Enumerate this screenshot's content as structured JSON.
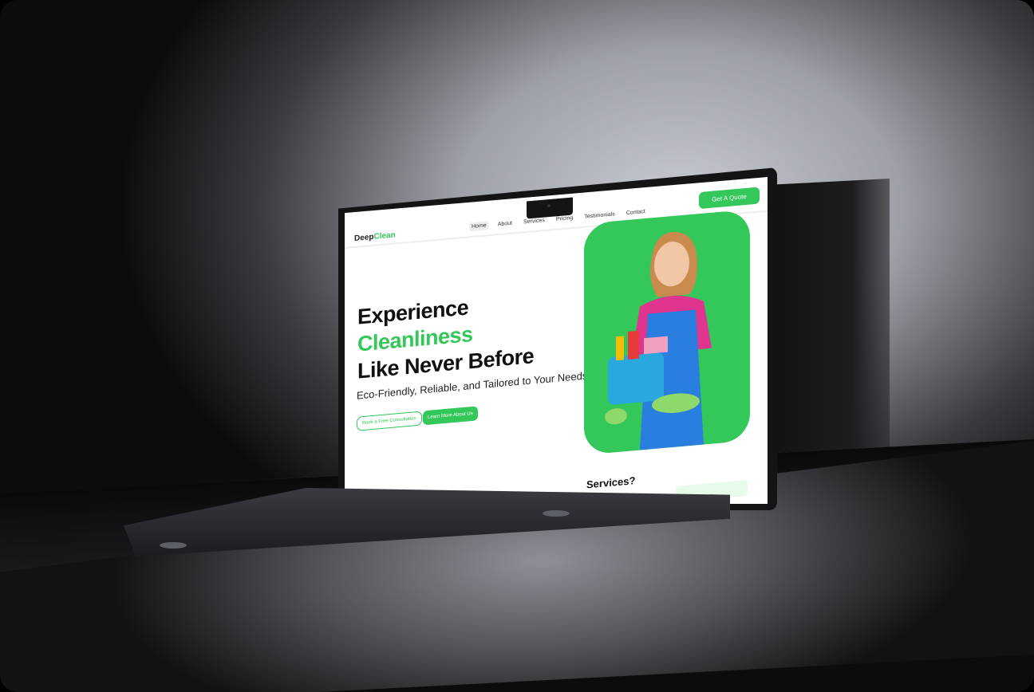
{
  "site": {
    "logo": {
      "part1": "Deep",
      "part2": "Clean"
    },
    "nav": [
      {
        "label": "Home",
        "active": true
      },
      {
        "label": "About"
      },
      {
        "label": "Services"
      },
      {
        "label": "Pricing"
      },
      {
        "label": "Testimonials"
      },
      {
        "label": "Contact"
      }
    ],
    "cta": "Get A Quote",
    "hero": {
      "line1": "Experience",
      "line2": "Cleanliness",
      "line3": "Like Never Before",
      "subtitle": "Eco-Friendly, Reliable, and Tailored to Your Needs",
      "primary_button": "Book a Free Consultation",
      "secondary_button": "Learn More About Us"
    },
    "next_section_heading": "Services?"
  },
  "colors": {
    "accent": "#34c759"
  }
}
